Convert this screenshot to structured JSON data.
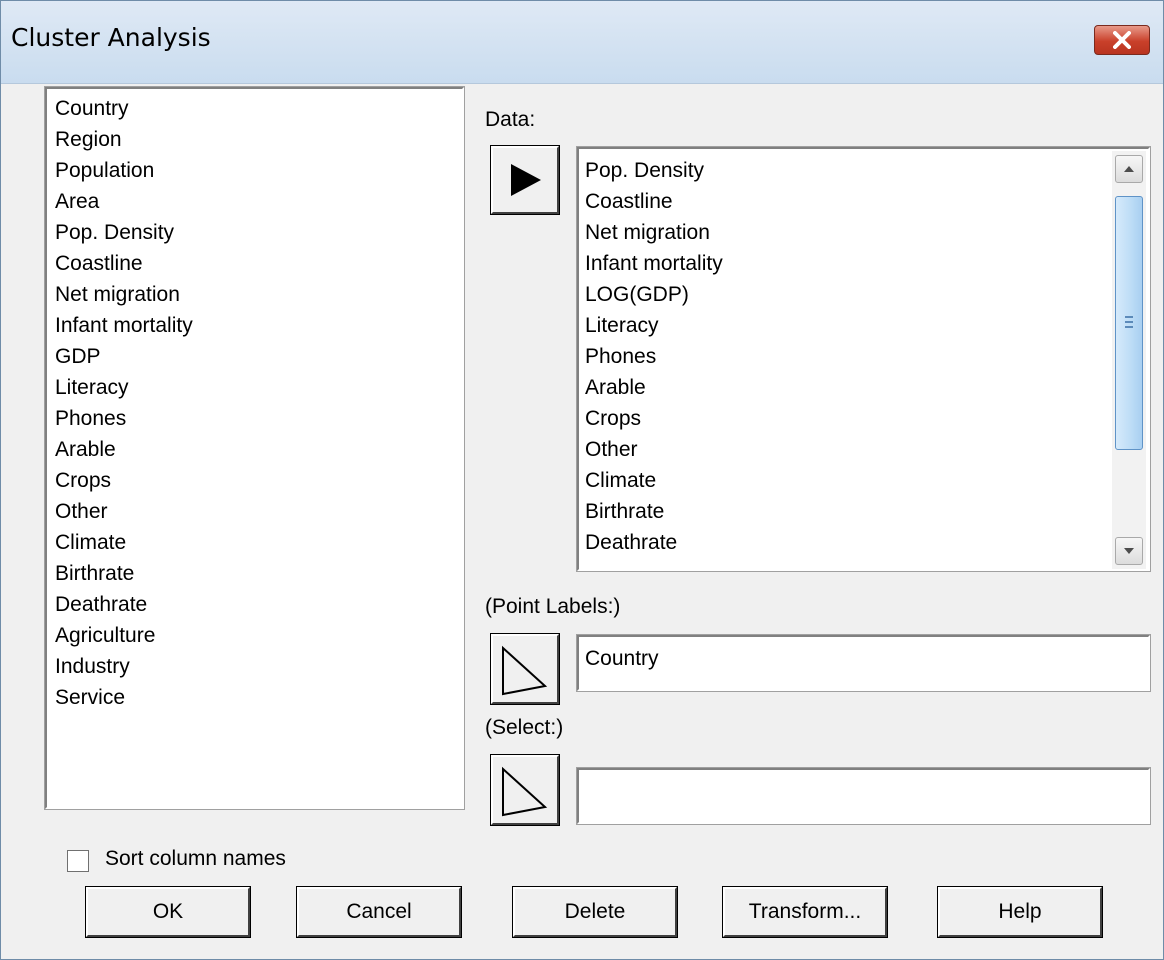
{
  "window": {
    "title": "Cluster Analysis"
  },
  "variables": [
    "Country",
    "Region",
    "Population",
    "Area",
    "Pop. Density",
    "Coastline",
    "Net migration",
    "Infant mortality",
    "GDP",
    "Literacy",
    "Phones",
    "Arable",
    "Crops",
    "Other",
    "Climate",
    "Birthrate",
    "Deathrate",
    "Agriculture",
    "Industry",
    "Service"
  ],
  "data": {
    "label": "Data:",
    "items": [
      "Pop. Density",
      "Coastline",
      "Net migration",
      "Infant mortality",
      "LOG(GDP)",
      "Literacy",
      "Phones",
      "Arable",
      "Crops",
      "Other",
      "Climate",
      "Birthrate",
      "Deathrate"
    ]
  },
  "point_labels": {
    "label": "(Point Labels:)",
    "value": "Country"
  },
  "select": {
    "label": "(Select:)",
    "value": ""
  },
  "sort": {
    "label": "Sort column names",
    "checked": false
  },
  "buttons": {
    "ok": "OK",
    "cancel": "Cancel",
    "delete": "Delete",
    "transform": "Transform...",
    "help": "Help"
  }
}
